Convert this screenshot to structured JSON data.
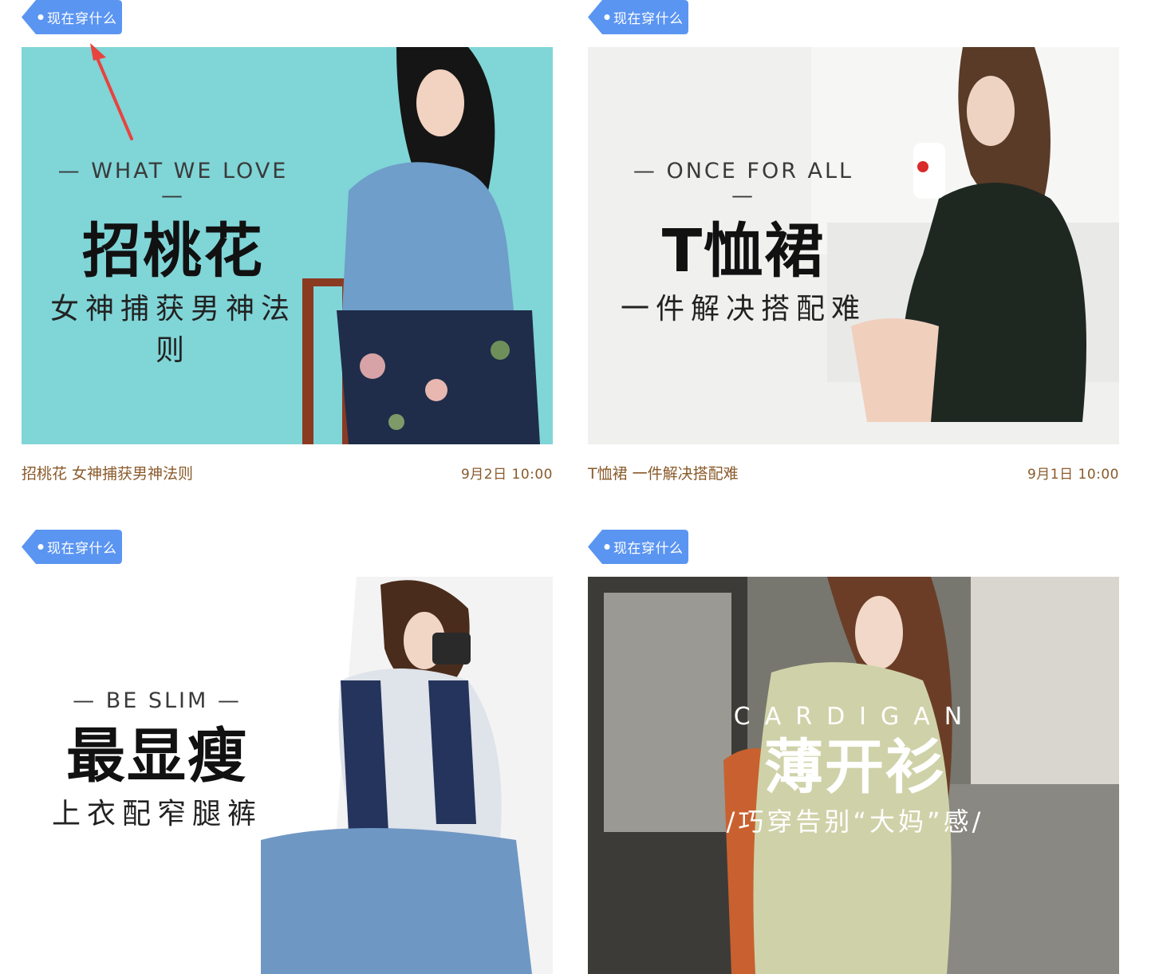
{
  "cards": [
    {
      "tag": "现在穿什么",
      "banner": {
        "en": "— WHAT WE LOVE —",
        "title": "招桃花",
        "subtitle": "女神捕获男神法则"
      },
      "caption": "招桃花 女神捕获男神法则",
      "date": "9月2日 10:00"
    },
    {
      "tag": "现在穿什么",
      "banner": {
        "en": "— ONCE FOR ALL —",
        "title": "T恤裙",
        "subtitle": "一件解决搭配难"
      },
      "caption": "T恤裙 一件解决搭配难",
      "date": "9月1日 10:00"
    },
    {
      "tag": "现在穿什么",
      "banner": {
        "en": "— BE SLIM —",
        "title": "最显瘦",
        "subtitle": "上衣配窄腿裤"
      }
    },
    {
      "tag": "现在穿什么",
      "banner": {
        "en": "CARDIGAN",
        "title": "薄开衫",
        "subtitle": "/巧穿告别“大妈”感/"
      }
    }
  ],
  "colors": {
    "tag_blue": "#5b95f2",
    "caption_brown": "#8a5a2b",
    "arrow_red": "#e8433f"
  }
}
